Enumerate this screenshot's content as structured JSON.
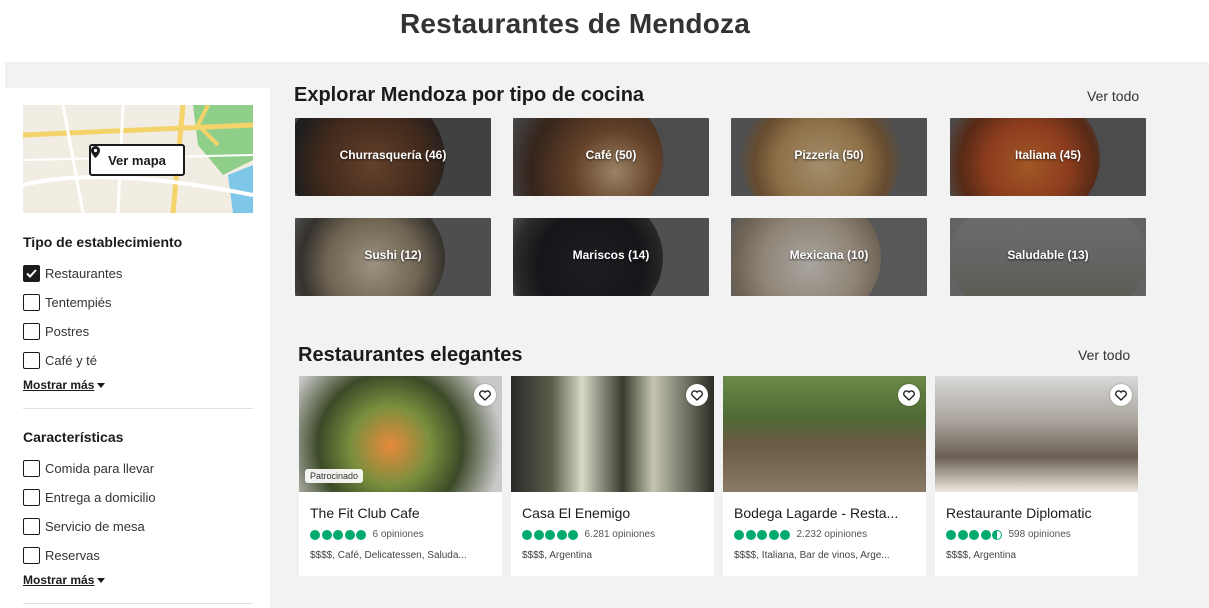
{
  "page": {
    "title": "Restaurantes de Mendoza"
  },
  "sidebar": {
    "map_button": "Ver mapa",
    "establishment": {
      "title": "Tipo de establecimiento",
      "items": [
        {
          "label": "Restaurantes",
          "checked": true
        },
        {
          "label": "Tentempiés",
          "checked": false
        },
        {
          "label": "Postres",
          "checked": false
        },
        {
          "label": "Café y té",
          "checked": false
        }
      ],
      "show_more": "Mostrar más"
    },
    "features": {
      "title": "Características",
      "items": [
        {
          "label": "Comida para llevar",
          "checked": false
        },
        {
          "label": "Entrega a domicilio",
          "checked": false
        },
        {
          "label": "Servicio de mesa",
          "checked": false
        },
        {
          "label": "Reservas",
          "checked": false
        }
      ],
      "show_more": "Mostrar más"
    }
  },
  "cuisines": {
    "title": "Explorar Mendoza por tipo de cocina",
    "see_all": "Ver todo",
    "tiles": [
      {
        "label": "Churrasquería (46)",
        "color": "#6b4a35"
      },
      {
        "label": "Café (50)",
        "color": "#7a5a3f"
      },
      {
        "label": "Pizzería (50)",
        "color": "#b98f5a"
      },
      {
        "label": "Italiana (45)",
        "color": "#c4662f"
      },
      {
        "label": "Sushi (12)",
        "color": "#8b8070"
      },
      {
        "label": "Mariscos (14)",
        "color": "#2f2f33"
      },
      {
        "label": "Mexicana (10)",
        "color": "#c8c0b5"
      },
      {
        "label": "Saludable (13)",
        "color": "#a9a9a9"
      }
    ]
  },
  "elegant": {
    "title": "Restaurantes elegantes",
    "see_all": "Ver todo",
    "restaurants": [
      {
        "name": "The Fit Club Cafe",
        "rating": 5,
        "reviews": "6 opiniones",
        "meta": "$$$$, Café, Delicatessen, Saluda...",
        "sponsored": "Patrocinado"
      },
      {
        "name": "Casa El Enemigo",
        "rating": 5,
        "reviews": "6.281 opiniones",
        "meta": "$$$$, Argentina"
      },
      {
        "name": "Bodega Lagarde - Resta...",
        "rating": 5,
        "reviews": "2.232 opiniones",
        "meta": "$$$$, Italiana, Bar de vinos, Arge..."
      },
      {
        "name": "Restaurante Diplomatic",
        "rating": 4.5,
        "reviews": "598 opiniones",
        "meta": "$$$$, Argentina"
      }
    ]
  },
  "colors": {
    "rating_green": "#00aa6c",
    "text": "#1b1b1b",
    "page_bg": "#f2f2f2"
  }
}
